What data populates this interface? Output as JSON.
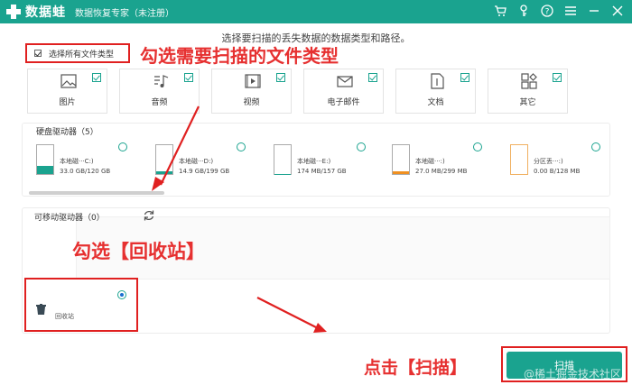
{
  "app": {
    "name": "数据蛙",
    "subtitle": "数据恢复专家（未注册）"
  },
  "instruction": "选择要扫描的丢失数据的数据类型和路径。",
  "select_all_label": "选择所有文件类型",
  "annotations": {
    "select_types": "勾选需要扫描的文件类型",
    "recycle": "勾选【回收站】",
    "scan": "点击【扫描】"
  },
  "file_types": [
    {
      "label": "图片",
      "icon": "image-icon",
      "checked": true
    },
    {
      "label": "音频",
      "icon": "music-icon",
      "checked": true
    },
    {
      "label": "视频",
      "icon": "video-icon",
      "checked": true
    },
    {
      "label": "电子邮件",
      "icon": "mail-icon",
      "checked": true
    },
    {
      "label": "文档",
      "icon": "document-icon",
      "checked": true
    },
    {
      "label": "其它",
      "icon": "other-icon",
      "checked": true
    }
  ],
  "hard_drives": {
    "title": "硬盘驱动器（5）",
    "items": [
      {
        "name": "本地磁···C:)",
        "size": "33.0 GB/120 GB",
        "fill": 0.28,
        "color": "#1aa38f"
      },
      {
        "name": "本地磁···D:)",
        "size": "14.9 GB/199 GB",
        "fill": 0.08,
        "color": "#1aa38f"
      },
      {
        "name": "本地磁···E:)",
        "size": "174 MB/157 GB",
        "fill": 0.01,
        "color": "#1aa38f"
      },
      {
        "name": "本地磁···:)",
        "size": "27.0 MB/299 MB",
        "fill": 0.09,
        "color": "#f09020"
      },
      {
        "name": "分区丢···:)",
        "size": "0.00  B/128 MB",
        "fill": 0.0,
        "color": "#f0b060"
      }
    ]
  },
  "removable": {
    "title": "可移动驱动器（0）"
  },
  "recycle_bin": {
    "label": "回收站",
    "selected": true
  },
  "scan_button": "扫描",
  "watermark": "@稀土掘金技术社区",
  "colors": {
    "accent": "#1aa38f",
    "annotation": "#e02020"
  }
}
